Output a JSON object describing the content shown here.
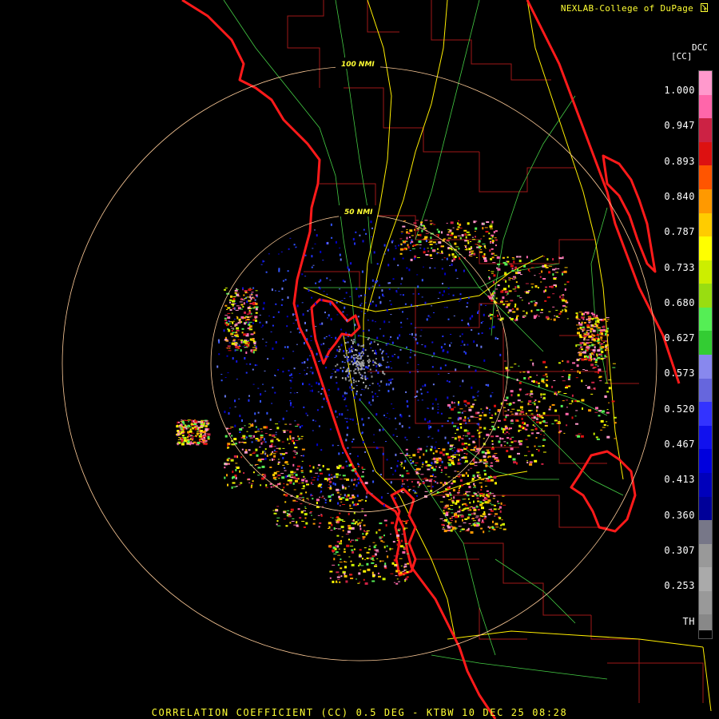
{
  "credit": "NEXLAB-College of DuPage",
  "credit_icon": "cursor-arrow-icon",
  "product_code": "DCC",
  "unit_label": "[CC]",
  "footer": "CORRELATION COEFFICIENT (CC) 0.5 DEG - KTBW 10 DEC 25 08:28",
  "range_rings": [
    {
      "label": "100 NMI",
      "range_nmi": 100
    },
    {
      "label": "50 NMI",
      "range_nmi": 50
    }
  ],
  "scale": {
    "ticks": [
      "1.000",
      "0.947",
      "0.893",
      "0.840",
      "0.787",
      "0.733",
      "0.680",
      "0.627",
      "0.573",
      "0.520",
      "0.467",
      "0.413",
      "0.360",
      "0.307",
      "0.253",
      "TH"
    ],
    "colors": [
      "#ff99cc",
      "#ff66aa",
      "#cc2244",
      "#dd1111",
      "#ff5500",
      "#ff9900",
      "#ffcc00",
      "#ffff00",
      "#ccee00",
      "#99dd11",
      "#55ee55",
      "#33cc33",
      "#8888ee",
      "#6666dd",
      "#3333ff",
      "#1111ee",
      "#0000dd",
      "#0000bb",
      "#000099",
      "#777788",
      "#999999",
      "#aaaaaa",
      "#999999",
      "#888888"
    ]
  },
  "colors": {
    "coastline": "#ff1111",
    "county": "#b01818",
    "highway": "#ffee00",
    "road": "#55dd55",
    "ring": "#ffcc99",
    "text": "#ffff33"
  }
}
